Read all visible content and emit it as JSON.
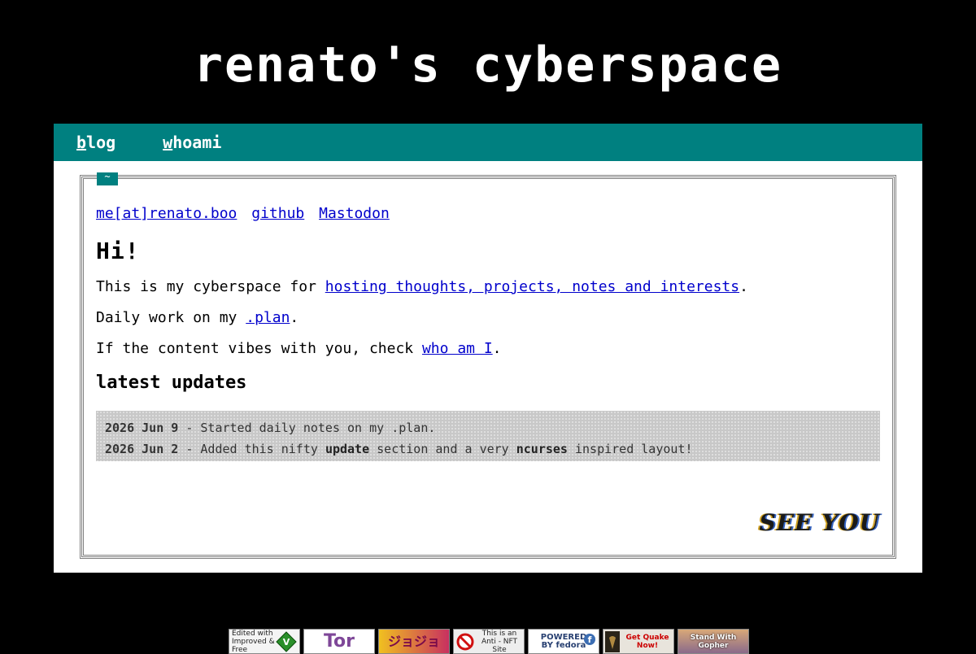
{
  "site": {
    "title": "renato's cyberspace"
  },
  "nav": [
    {
      "hotkey": "b",
      "rest": "log"
    },
    {
      "hotkey": "w",
      "rest": "hoami"
    }
  ],
  "frame": {
    "tab_label": "~"
  },
  "contacts": [
    "me[at]renato.boo",
    "github",
    "Mastodon"
  ],
  "greeting": "Hi!",
  "intro": {
    "line1_prefix": "This is my cyberspace for ",
    "line1_link": "hosting thoughts, projects, notes and interests",
    "line1_suffix": ".",
    "line2_prefix": "Daily work on my ",
    "line2_link": ".plan",
    "line2_suffix": ".",
    "line3_prefix": "If the content vibes with you, check ",
    "line3_link": "who am I",
    "line3_suffix": "."
  },
  "updates": {
    "heading": "latest updates",
    "rows": [
      {
        "date": "2026 Jun 9",
        "sep": " - ",
        "text": "Started daily notes on my .plan."
      },
      {
        "date": "2026 Jun 2",
        "sep": " - ",
        "text_a": "Added this nifty ",
        "bold_a": "update",
        "text_b": " section and a very ",
        "bold_b": "ncurses",
        "text_c": " inspired layout!"
      }
    ]
  },
  "marquee": "SEE YOU",
  "badges": [
    {
      "name": "vim-badge",
      "text": "Edited with Improved & Free"
    },
    {
      "name": "tor-badge",
      "text": "Tor"
    },
    {
      "name": "jojo-badge",
      "text": "ジョジョ"
    },
    {
      "name": "anti-nft-badge",
      "text": "This is an Anti - NFT Site"
    },
    {
      "name": "fedora-badge",
      "text": "POWERED BY fedora"
    },
    {
      "name": "quake-badge",
      "text": "Get Quake Now!"
    },
    {
      "name": "gopher-badge",
      "text": "Stand With Gopher"
    }
  ]
}
